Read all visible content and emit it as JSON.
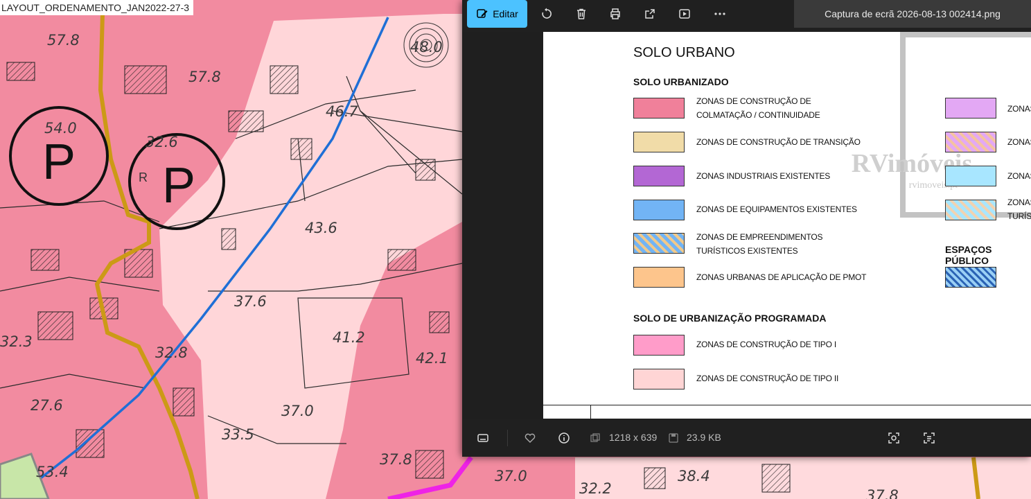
{
  "background_document": {
    "title": "LAYOUT_ORDENAMENTO_JAN2022-27-3",
    "elevations": [
      "57.8",
      "57.8",
      "54.0",
      "32.6",
      "46.7",
      "43.6",
      "37.6",
      "41.2",
      "42.1",
      "32.3",
      "32.8",
      "27.6",
      "37.0",
      "33.5",
      "37.8",
      "37.0",
      "38.4",
      "32.2",
      "53.4",
      "37.8",
      "48.0"
    ],
    "parking_symbol": "P",
    "r_label": "R"
  },
  "viewer": {
    "edit_label": "Editar",
    "toolbar_icons": [
      "edit-icon",
      "rotate-icon",
      "delete-icon",
      "print-icon",
      "share-icon",
      "slideshow-icon",
      "more-icon"
    ],
    "file_title": "Captura de ecrã 2026-08-13 002414.png",
    "dimensions": "1218 x 639",
    "file_size": "23.9 KB",
    "bottom_icons": [
      "filmstrip-icon",
      "favorite-icon",
      "info-icon",
      "dimensions-icon",
      "size-icon",
      "visual-search-icon",
      "text-extract-icon"
    ]
  },
  "legend": {
    "main_title": "SOLO URBANO",
    "section1": "SOLO URBANIZADO",
    "section2": "SOLO DE URBANIZAÇÃO PROGRAMADA",
    "section3": "ESPAÇOS PÚBLICO",
    "left_items": [
      {
        "line1": "ZONAS DE CONSTRUÇÃO DE",
        "line2": "COLMATAÇÃO / CONTINUIDADE",
        "color": "#f0809a"
      },
      {
        "line1": "ZONAS DE CONSTRUÇÃO DE TRANSIÇÃO",
        "line2": "",
        "color": "#f1dca8"
      },
      {
        "line1": "ZONAS INDUSTRIAIS EXISTENTES",
        "line2": "",
        "color": "#b367d4"
      },
      {
        "line1": "ZONAS DE EQUIPAMENTOS EXISTENTES",
        "line2": "",
        "color": "#72b4f5"
      },
      {
        "line1": "ZONAS DE EMPREENDIMENTOS",
        "line2": "TURÍSTICOS EXISTENTES",
        "color": "#72b4f5"
      },
      {
        "line1": "ZONAS URBANAS DE APLICAÇÃO DE PMOT",
        "line2": "",
        "color": "#fdc58c"
      }
    ],
    "programmed_items": [
      {
        "line1": "ZONAS DE CONSTRUÇÃO DE TIPO I",
        "color": "#ff9cc9"
      },
      {
        "line1": "ZONAS DE CONSTRUÇÃO DE TIPO II",
        "color": "#ffd5d5"
      }
    ],
    "right_items": [
      {
        "line1": "ZONAS",
        "line2": "",
        "color": "#e3a8f4"
      },
      {
        "line1": "ZONAS",
        "line2": "",
        "color": "#e3a8f4"
      },
      {
        "line1": "ZONAS",
        "line2": "",
        "color": "#a8e6ff"
      },
      {
        "line1": "ZONAS",
        "line2": "TURÍS",
        "color": "#a8e6ff"
      }
    ],
    "watermark": "RVimóveis",
    "watermark_url": "rvimoveis.pt"
  }
}
